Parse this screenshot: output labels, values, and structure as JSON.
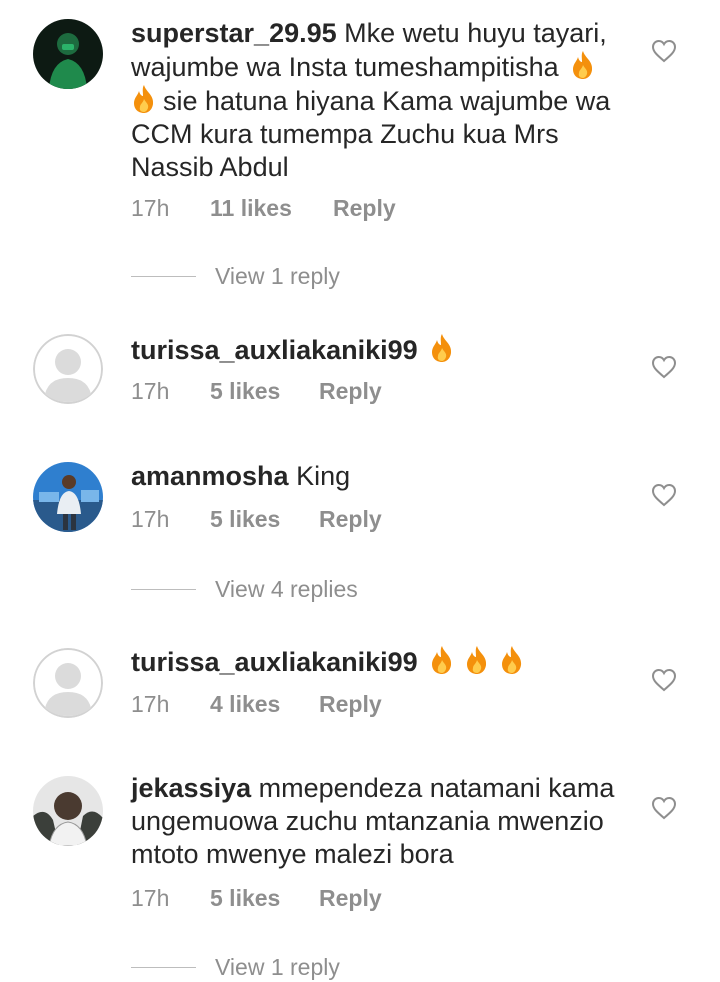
{
  "comments": [
    {
      "username": "superstar_29.95",
      "text": "Mke wetu huyu tayari, wajumbe wa Insta tumeshampitisha",
      "text2": "sie hatuna hiyana Kama wajumbe wa CCM kura tumempa Zuchu kua Mrs Nassib Abdul",
      "time": "17h",
      "likes": "11 likes",
      "reply": "Reply",
      "view_replies": "View 1 reply"
    },
    {
      "username": "turissa_auxliakaniki99",
      "text": "",
      "time": "17h",
      "likes": "5 likes",
      "reply": "Reply"
    },
    {
      "username": "amanmosha",
      "text": "King",
      "time": "17h",
      "likes": "5 likes",
      "reply": "Reply",
      "view_replies": "View 4 replies"
    },
    {
      "username": "turissa_auxliakaniki99",
      "text": "",
      "time": "17h",
      "likes": "4 likes",
      "reply": "Reply"
    },
    {
      "username": "jekassiya",
      "text": "mmependeza natamani kama ungemuowa zuchu mtanzania mwenzio mtoto mwenye malezi bora",
      "time": "17h",
      "likes": "5 likes",
      "reply": "Reply",
      "view_replies": "View 1 reply"
    }
  ],
  "icons": {
    "like": "heart-outline-icon",
    "emoji": "fire-emoji"
  },
  "colors": {
    "text": "#262626",
    "muted": "#8e8e8e",
    "fire": "#f4900c"
  }
}
